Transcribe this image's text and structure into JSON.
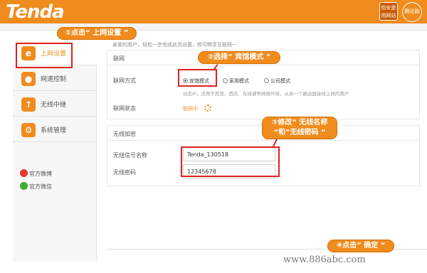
{
  "header": {
    "logo": "Tenda",
    "badge_line1": "怡安是",
    "badge_line2": "用网站",
    "seal_text": "腾达路由"
  },
  "sidebar": {
    "items": [
      {
        "label": "上网设置",
        "icon": "globe-e-icon"
      },
      {
        "label": "网速控制",
        "icon": "users-icon"
      },
      {
        "label": "无线中继",
        "icon": "wifi-relay-icon"
      },
      {
        "label": "系统管理",
        "icon": "gear-icon"
      }
    ],
    "social": [
      {
        "label": "官方微博",
        "icon": "weibo-icon"
      },
      {
        "label": "官方微信",
        "icon": "wechat-icon"
      }
    ]
  },
  "main": {
    "notice": "亲爱的用户，轻松一步完成此页设置，即可畅享互联网~",
    "internet": {
      "title": "联网",
      "mode_label": "联网方式",
      "modes": [
        "宾馆模式",
        "家用模式",
        "公司模式"
      ],
      "selected_mode": "宾馆模式",
      "hint": "动态IP，适用于宾馆、酒店、有线通等网络环境，从另一个路由器接线上网的用户",
      "status_label": "联网状态",
      "status_value": "联网中"
    },
    "wireless": {
      "title": "无线加密",
      "ssid_label": "无线信号名称",
      "ssid_value": "Tenda_130518",
      "password_label": "无线密码",
      "password_value": "12345678"
    }
  },
  "annotations": {
    "step1": "①点击“ 上网设置 ”",
    "step2": "②选择” 宾馆模式 “",
    "step3_line1": "③修改” 无线名称",
    "step3_line2": "“和”无线密码 “",
    "step4": "④点击” 确定 “"
  },
  "watermark": "www.886abc.com",
  "colors": {
    "brand": "#f08c1e",
    "annotation_red": "#e02020"
  }
}
